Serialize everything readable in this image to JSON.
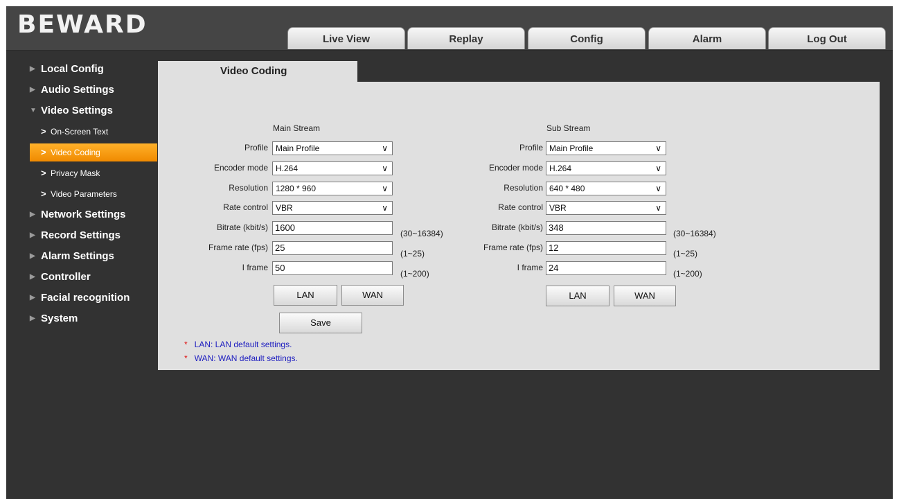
{
  "app": {
    "logo": "BEWARD"
  },
  "nav": {
    "tabs": [
      {
        "label": "Live View"
      },
      {
        "label": "Replay"
      },
      {
        "label": "Config"
      },
      {
        "label": "Alarm"
      },
      {
        "label": "Log Out"
      }
    ],
    "active_tab": "Config"
  },
  "sidebar": {
    "sections": [
      {
        "label": "Local Config"
      },
      {
        "label": "Audio Settings"
      },
      {
        "label": "Video Settings",
        "expanded": true,
        "items": [
          {
            "label": "On-Screen Text"
          },
          {
            "label": "Video Coding",
            "active": true
          },
          {
            "label": "Privacy Mask"
          },
          {
            "label": "Video Parameters"
          }
        ]
      },
      {
        "label": "Network Settings"
      },
      {
        "label": "Record Settings"
      },
      {
        "label": "Alarm Settings"
      },
      {
        "label": "Controller"
      },
      {
        "label": "Facial recognition"
      },
      {
        "label": "System"
      }
    ]
  },
  "content": {
    "tab_title": "Video Coding",
    "labels": {
      "profile": "Profile",
      "encoder_mode": "Encoder mode",
      "resolution": "Resolution",
      "rate_control": "Rate control",
      "bitrate": "Bitrate (kbit/s)",
      "frame_rate": "Frame rate (fps)",
      "i_frame": "I frame"
    },
    "main": {
      "title": "Main Stream",
      "profile": "Main Profile",
      "encoder_mode": "H.264",
      "resolution": "1280 * 960",
      "rate_control": "VBR",
      "bitrate": "1600",
      "bitrate_range": "(30~16384)",
      "frame_rate": "25",
      "frame_rate_range": "(1~25)",
      "i_frame": "50",
      "i_frame_range": "(1~200)",
      "lan_label": "LAN",
      "wan_label": "WAN"
    },
    "sub": {
      "title": "Sub Stream",
      "profile": "Main Profile",
      "encoder_mode": "H.264",
      "resolution": "640 * 480",
      "rate_control": "VBR",
      "bitrate": "348",
      "bitrate_range": "(30~16384)",
      "frame_rate": "12",
      "frame_rate_range": "(1~25)",
      "i_frame": "24",
      "i_frame_range": "(1~200)",
      "lan_label": "LAN",
      "wan_label": "WAN"
    },
    "save_label": "Save",
    "notes": [
      {
        "star": "*",
        "text": "LAN: LAN default settings."
      },
      {
        "star": "*",
        "text": "WAN: WAN default settings."
      }
    ]
  },
  "colors": {
    "accent": "#f59a10",
    "background": "#323232",
    "header": "#454545",
    "panel": "#e0e0e0",
    "note_text": "#2020c0",
    "note_star": "#e01010"
  }
}
